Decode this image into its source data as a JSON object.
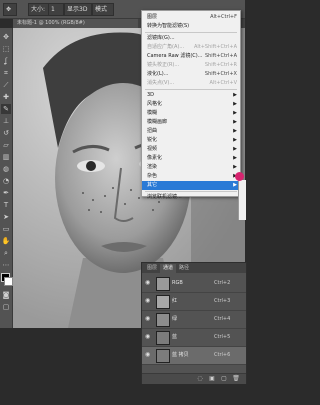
{
  "options_bar": {
    "label_size": "大小:",
    "value_size": "1",
    "label_3d": "显示3D",
    "label_mode": "模式"
  },
  "document_tab": {
    "title": "未标题-1 @ 100% (RGB/8#)"
  },
  "menu": {
    "items": [
      {
        "label": "图层",
        "shortcut": "",
        "submenu": false,
        "disabled": false,
        "highlighted": false,
        "id": "layers"
      },
      {
        "label": "转换为智能滤镜(S)",
        "shortcut": "",
        "submenu": false,
        "disabled": false,
        "highlighted": false,
        "id": "convert-smart"
      },
      {
        "label": "滤镜库(G)...",
        "shortcut": "",
        "submenu": false,
        "disabled": false,
        "highlighted": false,
        "id": "filter-gallery"
      },
      {
        "label": "自适应广角(A)...",
        "shortcut": "Alt+Shift+Ctrl+A",
        "submenu": false,
        "disabled": true,
        "highlighted": false,
        "id": "adaptive-wide"
      },
      {
        "label": "Camera Raw 滤镜(C)...",
        "shortcut": "Shift+Ctrl+A",
        "submenu": false,
        "disabled": false,
        "highlighted": false,
        "id": "camera-raw"
      },
      {
        "label": "镜头校正(R)...",
        "shortcut": "Shift+Ctrl+R",
        "submenu": false,
        "disabled": true,
        "highlighted": false,
        "id": "lens-correction"
      },
      {
        "label": "液化(L)...",
        "shortcut": "Shift+Ctrl+X",
        "submenu": false,
        "disabled": false,
        "highlighted": false,
        "id": "liquify"
      },
      {
        "label": "消失点(V)...",
        "shortcut": "Alt+Ctrl+V",
        "submenu": false,
        "disabled": true,
        "highlighted": false,
        "id": "vanishing-point"
      },
      {
        "label": "3D",
        "shortcut": "",
        "submenu": true,
        "disabled": false,
        "highlighted": false,
        "id": "3d"
      },
      {
        "label": "风格化",
        "shortcut": "",
        "submenu": true,
        "disabled": false,
        "highlighted": false,
        "id": "stylize"
      },
      {
        "label": "模糊",
        "shortcut": "",
        "submenu": true,
        "disabled": false,
        "highlighted": false,
        "id": "blur"
      },
      {
        "label": "模糊画廊",
        "shortcut": "",
        "submenu": true,
        "disabled": false,
        "highlighted": false,
        "id": "blur-gallery"
      },
      {
        "label": "扭曲",
        "shortcut": "",
        "submenu": true,
        "disabled": false,
        "highlighted": false,
        "id": "distort"
      },
      {
        "label": "锐化",
        "shortcut": "",
        "submenu": true,
        "disabled": false,
        "highlighted": false,
        "id": "sharpen"
      },
      {
        "label": "视频",
        "shortcut": "",
        "submenu": true,
        "disabled": false,
        "highlighted": false,
        "id": "video"
      },
      {
        "label": "像素化",
        "shortcut": "",
        "submenu": true,
        "disabled": false,
        "highlighted": false,
        "id": "pixelate"
      },
      {
        "label": "渲染",
        "shortcut": "",
        "submenu": true,
        "disabled": false,
        "highlighted": false,
        "id": "render"
      },
      {
        "label": "杂色",
        "shortcut": "",
        "submenu": true,
        "disabled": false,
        "highlighted": false,
        "id": "noise"
      },
      {
        "label": "其它",
        "shortcut": "",
        "submenu": true,
        "disabled": false,
        "highlighted": true,
        "id": "other"
      },
      {
        "label": "浏览联机滤镜...",
        "shortcut": "",
        "submenu": false,
        "disabled": false,
        "highlighted": false,
        "id": "browse-online"
      }
    ],
    "top_shortcut": "Alt+Ctrl+F"
  },
  "layers_panel": {
    "tabs": [
      "图层",
      "通道",
      "路径"
    ],
    "active_tab": 1,
    "rows": [
      {
        "name": "RGB",
        "shortcut": "Ctrl+2",
        "selected": false,
        "visible": true
      },
      {
        "name": "红",
        "shortcut": "Ctrl+3",
        "selected": false,
        "visible": true
      },
      {
        "name": "绿",
        "shortcut": "Ctrl+4",
        "selected": false,
        "visible": true
      },
      {
        "name": "蓝",
        "shortcut": "Ctrl+5",
        "selected": false,
        "visible": true
      },
      {
        "name": "蓝 拷贝",
        "shortcut": "Ctrl+6",
        "selected": true,
        "visible": true
      }
    ]
  },
  "colors": {
    "highlight": "#2a7ad6",
    "cursor": "#d6246f",
    "ui_dark": "#535353"
  },
  "icons": [
    "move-icon",
    "marquee-icon",
    "lasso-icon",
    "crop-icon",
    "eyedropper-icon",
    "brush-icon",
    "stamp-icon",
    "eraser-icon",
    "gradient-icon",
    "dodge-icon",
    "pen-icon",
    "text-icon",
    "path-select-icon",
    "shape-icon",
    "hand-icon",
    "zoom-icon"
  ]
}
